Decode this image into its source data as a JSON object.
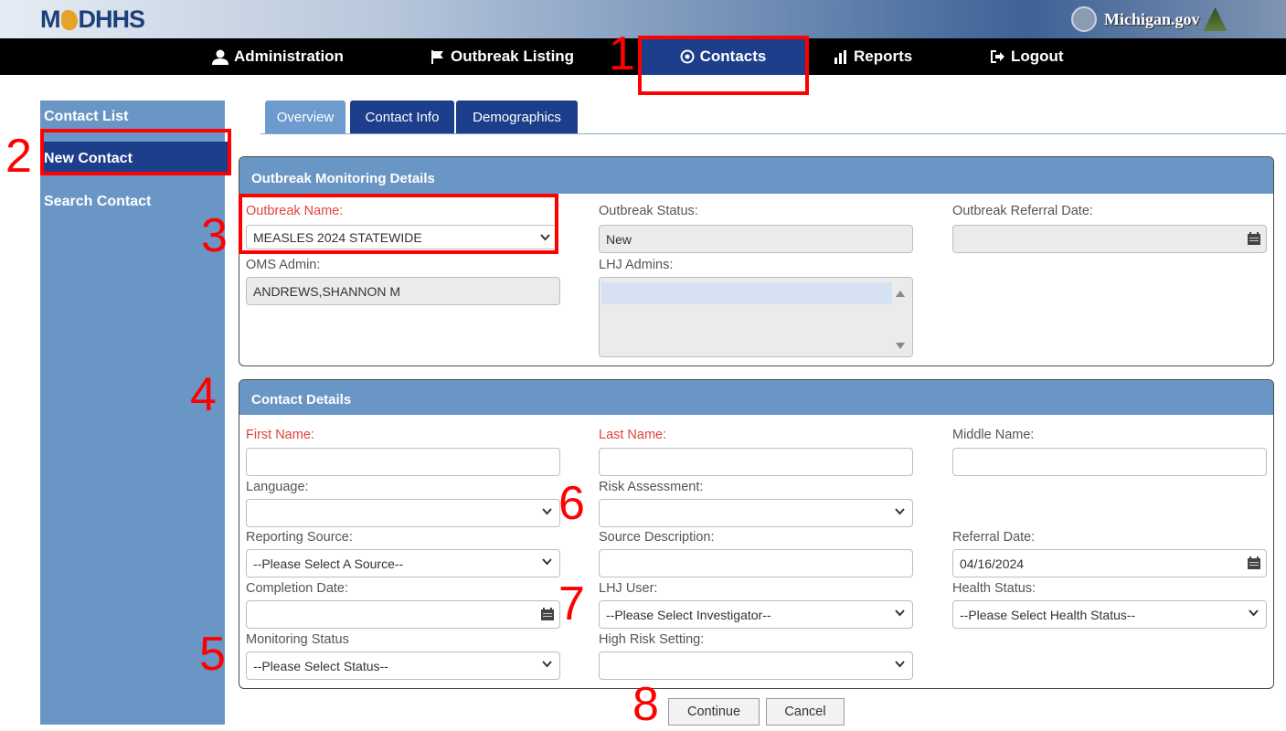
{
  "header": {
    "logo_prefix": "M",
    "logo_suffix": "DHHS",
    "michigan_gov": "Michigan.gov"
  },
  "nav": {
    "administration": "Administration",
    "outbreak_listing": "Outbreak Listing",
    "contacts": "Contacts",
    "reports": "Reports",
    "logout": "Logout"
  },
  "sidebar": {
    "items": [
      {
        "label": "Contact List"
      },
      {
        "label": "New Contact"
      },
      {
        "label": "Search Contact"
      }
    ]
  },
  "tabs": [
    {
      "label": "Overview"
    },
    {
      "label": "Contact Info"
    },
    {
      "label": "Demographics"
    }
  ],
  "outbreak_panel": {
    "title": "Outbreak Monitoring Details",
    "outbreak_name_label": "Outbreak Name:",
    "outbreak_name_value": "MEASLES 2024 STATEWIDE",
    "outbreak_status_label": "Outbreak Status:",
    "outbreak_status_value": "New",
    "referral_date_label": "Outbreak Referral Date:",
    "referral_date_value": "",
    "oms_admin_label": "OMS Admin:",
    "oms_admin_value": "ANDREWS,SHANNON M",
    "lhj_admins_label": "LHJ Admins:"
  },
  "contact_panel": {
    "title": "Contact Details",
    "first_name_label": "First Name:",
    "last_name_label": "Last Name:",
    "middle_name_label": "Middle Name:",
    "language_label": "Language:",
    "risk_assessment_label": "Risk Assessment:",
    "reporting_source_label": "Reporting Source:",
    "reporting_source_value": "--Please Select A Source--",
    "source_description_label": "Source Description:",
    "referral_date_label": "Referral Date:",
    "referral_date_value": "04/16/2024",
    "completion_date_label": "Completion Date:",
    "lhj_user_label": "LHJ User:",
    "lhj_user_value": "--Please Select Investigator--",
    "health_status_label": "Health Status:",
    "health_status_value": "--Please Select Health Status--",
    "monitoring_status_label": "Monitoring Status",
    "monitoring_status_value": "--Please Select Status--",
    "high_risk_setting_label": "High Risk Setting:"
  },
  "buttons": {
    "continue": "Continue",
    "cancel": "Cancel"
  },
  "annotations": [
    "1",
    "2",
    "3",
    "4",
    "5",
    "6",
    "7",
    "8"
  ],
  "colors": {
    "nav_bg": "#000000",
    "active_blue": "#1d3e8a",
    "panel_head": "#6a96c6",
    "required_label": "#e0443b",
    "annotation_red": "#ff0000"
  }
}
